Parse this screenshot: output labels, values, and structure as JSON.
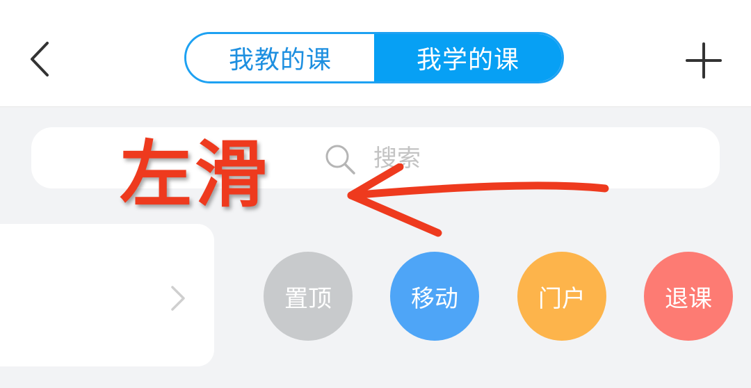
{
  "header": {
    "tabs": [
      {
        "label": "我教的课",
        "active": false
      },
      {
        "label": "我学的课",
        "active": true
      }
    ],
    "back_icon": "chevron-left-icon",
    "add_icon": "plus-icon"
  },
  "search": {
    "placeholder": "搜索",
    "icon": "search-icon"
  },
  "annotation": {
    "text": "左滑",
    "color": "#ee3a1e"
  },
  "course_card": {
    "chevron_icon": "chevron-right-icon"
  },
  "actions": [
    {
      "label": "置顶",
      "color": "#c8cacc"
    },
    {
      "label": "移动",
      "color": "#4ea5f7"
    },
    {
      "label": "门户",
      "color": "#fdb44b"
    },
    {
      "label": "退课",
      "color": "#fd7b73"
    }
  ],
  "colors": {
    "accent": "#07a0f4",
    "background": "#f2f3f5"
  }
}
